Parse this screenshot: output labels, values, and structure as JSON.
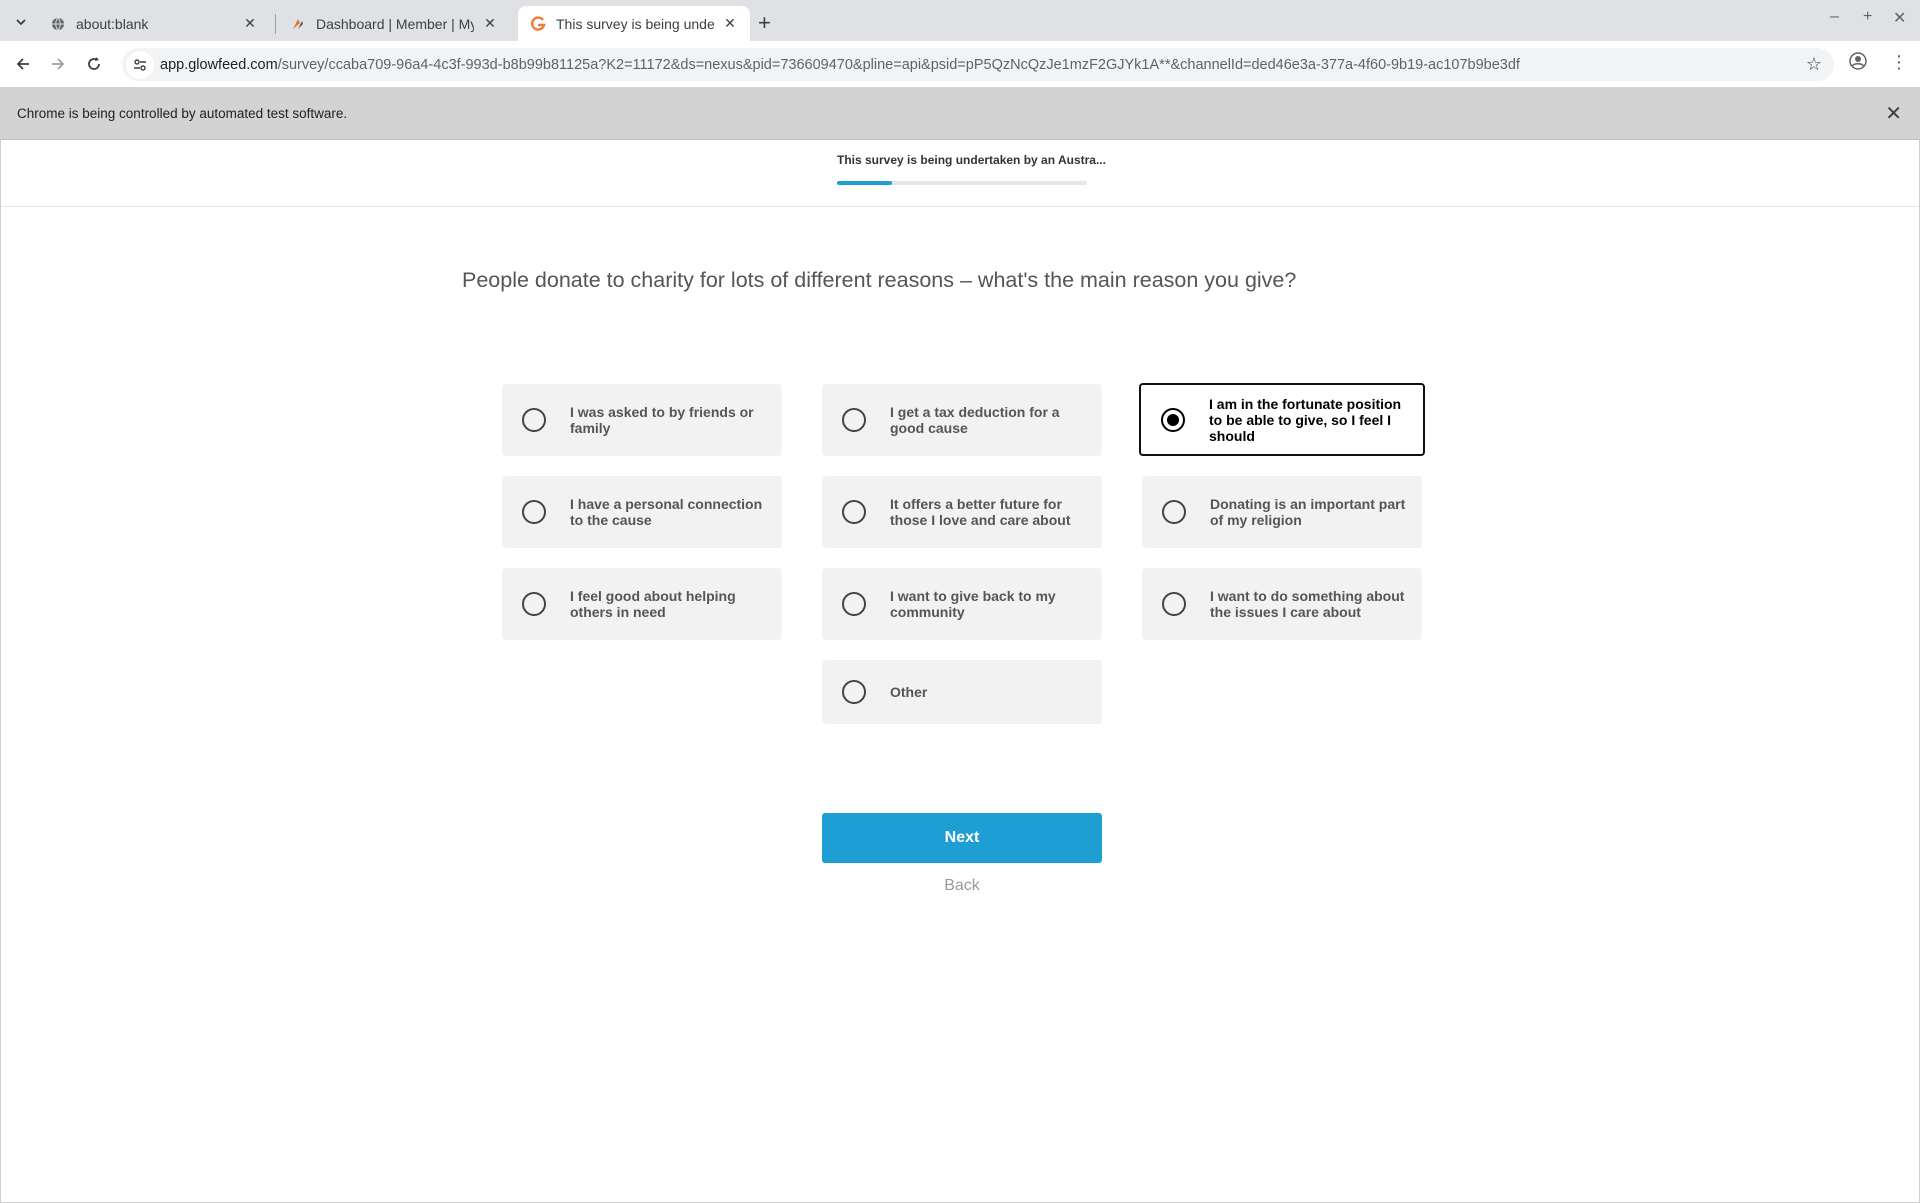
{
  "browser": {
    "tabs": [
      {
        "label": "about:blank",
        "icon": "globe-icon"
      },
      {
        "label": "Dashboard | Member | MyOpinions",
        "icon": "myopinions-favicon"
      },
      {
        "label": "This survey is being undertaken by an Australian",
        "icon": "glowfeed-favicon"
      }
    ],
    "url_host": "app.glowfeed.com",
    "url_path": "/survey/ccaba709-96a4-4c3f-993d-b8b99b81125a?K2=11172&ds=nexus&pid=736609470&pline=api&psid=pP5QzNcQzJe1mzF2GJYk1A**&channelId=ded46e3a-377a-4f60-9b19-ac107b9be3df",
    "infobar_message": "Chrome is being controlled by automated test software."
  },
  "survey": {
    "header_title": "This survey is being undertaken by an Austra...",
    "progress": 0.22,
    "question": "People donate to charity for lots of different reasons – what's the main reason you give?",
    "options": [
      {
        "label": "I was asked to by friends or family",
        "selected": false
      },
      {
        "label": "I get a tax deduction for a good cause",
        "selected": false
      },
      {
        "label": "I am in the fortunate position to be able to give, so I feel I should",
        "selected": true
      },
      {
        "label": "I have a personal connection to the cause",
        "selected": false
      },
      {
        "label": "It offers a better future for those I love and care about",
        "selected": false
      },
      {
        "label": "Donating is an important part of my religion",
        "selected": false
      },
      {
        "label": "I feel good about helping others in need",
        "selected": false
      },
      {
        "label": "I want to give back to my community",
        "selected": false
      },
      {
        "label": "I want to do something about the issues I care about",
        "selected": false
      },
      {
        "label": "Other",
        "selected": false
      }
    ],
    "next_label": "Next",
    "back_label": "Back"
  },
  "colors": {
    "accent": "#1e9fd4",
    "selected_border": "#111111",
    "option_bg": "#f2f2f2"
  }
}
